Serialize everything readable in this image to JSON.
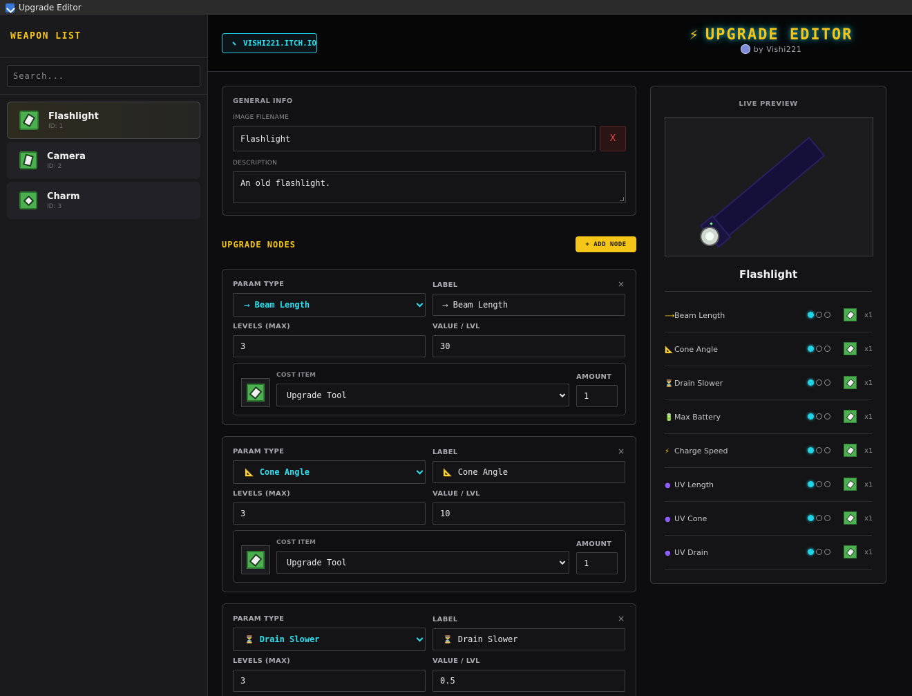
{
  "window": {
    "title": "Upgrade Editor"
  },
  "sidebar": {
    "title": "WEAPON LIST",
    "search_placeholder": "Search...",
    "items": [
      {
        "name": "Flashlight",
        "id": "ID: 1",
        "active": true
      },
      {
        "name": "Camera",
        "id": "ID: 2",
        "active": false
      },
      {
        "name": "Charm",
        "id": "ID: 3",
        "active": false
      }
    ]
  },
  "header": {
    "link_label": "VISHI221.ITCH.IO",
    "brand_icon": "⚡",
    "brand_title": "UPGRADE EDITOR",
    "brand_byline": "by Vishi221"
  },
  "general": {
    "section_label": "GENERAL INFO",
    "image_label": "IMAGE FILENAME",
    "image_value": "Flashlight",
    "clear_label": "X",
    "description_label": "DESCRIPTION",
    "description_value": "An old flashlight."
  },
  "nodes_section": {
    "title": "UPGRADE NODES",
    "add_label": "+ ADD NODE"
  },
  "node_labels": {
    "param_type": "PARAM TYPE",
    "label": "LABEL",
    "levels": "LEVELS (MAX)",
    "value": "VALUE / LVL",
    "cost_item": "COST ITEM",
    "amount": "AMOUNT",
    "close": "×"
  },
  "nodes": [
    {
      "param_icon": "⟶",
      "param_type": "Beam Length",
      "label_icon": "⟶",
      "label": "Beam Length",
      "levels": "3",
      "value": "30",
      "cost_item": "Upgrade Tool",
      "amount": "1"
    },
    {
      "param_icon": "📐",
      "param_type": "Cone Angle",
      "label_icon": "📐",
      "label": "Cone Angle",
      "levels": "3",
      "value": "10",
      "cost_item": "Upgrade Tool",
      "amount": "1"
    },
    {
      "param_icon": "⏳",
      "param_type": "Drain Slower",
      "label_icon": "⏳",
      "label": "Drain Slower",
      "levels": "3",
      "value": "0.5"
    }
  ],
  "preview": {
    "title": "LIVE PREVIEW",
    "name": "Flashlight",
    "stats": [
      {
        "icon": "⟶",
        "name": "Beam Length",
        "filled": 1,
        "total": 3,
        "mult": "x1"
      },
      {
        "icon": "📐",
        "name": "Cone Angle",
        "filled": 1,
        "total": 3,
        "mult": "x1"
      },
      {
        "icon": "⏳",
        "name": "Drain Slower",
        "filled": 1,
        "total": 3,
        "mult": "x1"
      },
      {
        "icon": "🔋",
        "name": "Max Battery",
        "filled": 1,
        "total": 3,
        "mult": "x1"
      },
      {
        "icon": "⚡",
        "name": "Charge Speed",
        "filled": 1,
        "total": 3,
        "mult": "x1"
      },
      {
        "icon": "●",
        "name": "UV Length",
        "filled": 1,
        "total": 3,
        "mult": "x1"
      },
      {
        "icon": "●",
        "name": "UV Cone",
        "filled": 1,
        "total": 3,
        "mult": "x1"
      },
      {
        "icon": "●",
        "name": "UV Drain",
        "filled": 1,
        "total": 3,
        "mult": "x1"
      }
    ]
  },
  "colors": {
    "accent_yellow": "#f5c518",
    "accent_cyan": "#22d3e6",
    "panel": "#121214",
    "uv_purple": "#8b5cf6"
  }
}
